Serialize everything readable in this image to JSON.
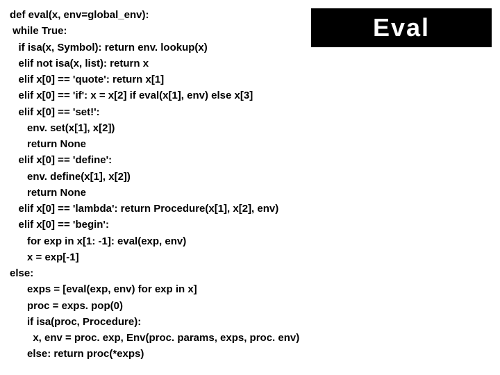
{
  "title": "Eval",
  "code": {
    "l01": "def eval(x, env=global_env):",
    "l02": " while True:",
    "l03": "   if isa(x, Symbol): return env. lookup(x)",
    "l04": "   elif not isa(x, list): return x",
    "l05": "   elif x[0] == 'quote': return x[1]",
    "l06": "   elif x[0] == 'if': x = x[2] if eval(x[1], env) else x[3]",
    "l07": "   elif x[0] == 'set!':",
    "l08": "      env. set(x[1], x[2])",
    "l09": "      return None",
    "l10": "   elif x[0] == 'define':",
    "l11": "      env. define(x[1], x[2])",
    "l12": "      return None",
    "l13": "   elif x[0] == 'lambda': return Procedure(x[1], x[2], env)",
    "l14": "   elif x[0] == 'begin':",
    "l15": "      for exp in x[1: -1]: eval(exp, env)",
    "l16": "      x = exp[-1]",
    "l17": "else:",
    "l18": "      exps = [eval(exp, env) for exp in x]",
    "l19": "      proc = exps. pop(0)",
    "l20": "      if isa(proc, Procedure):",
    "l21": "        x, env = proc. exp, Env(proc. params, exps, proc. env)",
    "l22": "      else: return proc(*exps)"
  }
}
